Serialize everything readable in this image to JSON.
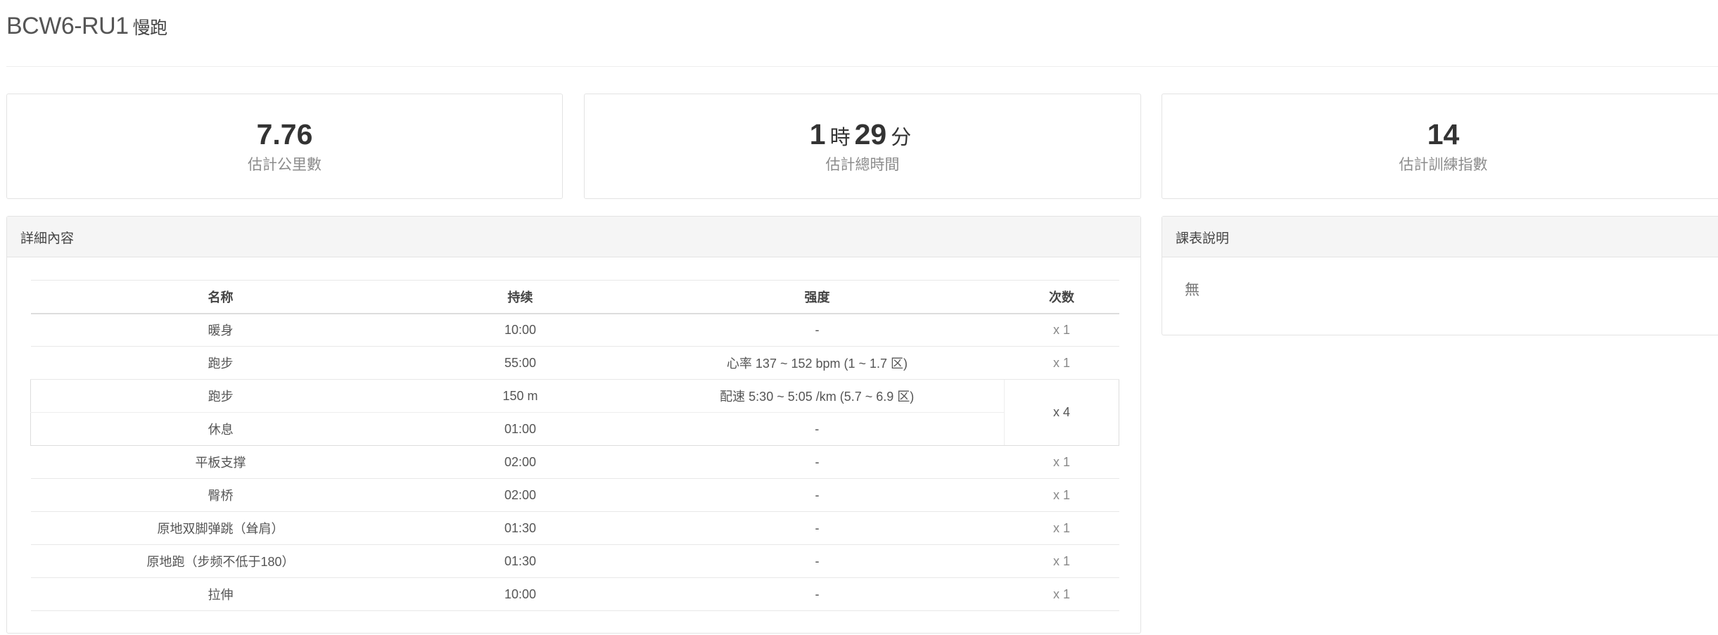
{
  "header": {
    "title": "BCW6-RU1",
    "subtitle": "慢跑"
  },
  "stats": {
    "distance": {
      "value": "7.76",
      "label": "估計公里數"
    },
    "duration": {
      "hours": "1",
      "hours_unit": "時",
      "minutes": "29",
      "minutes_unit": "分",
      "label": "估計總時間"
    },
    "training_index": {
      "value": "14",
      "label": "估計訓練指數"
    }
  },
  "detail": {
    "heading": "詳細內容",
    "columns": [
      "名称",
      "持续",
      "强度",
      "次数"
    ],
    "rows": [
      {
        "name": "暖身",
        "duration": "10:00",
        "intensity": "-",
        "count": "x 1"
      },
      {
        "name": "跑步",
        "duration": "55:00",
        "intensity": "心率 137 ~ 152 bpm (1 ~ 1.7 区)",
        "count": "x 1"
      }
    ],
    "group": {
      "count": "x 4",
      "rows": [
        {
          "name": "跑步",
          "duration": "150 m",
          "intensity": "配速 5:30 ~ 5:05 /km (5.7 ~ 6.9 区)"
        },
        {
          "name": "休息",
          "duration": "01:00",
          "intensity": "-"
        }
      ]
    },
    "rows_after": [
      {
        "name": "平板支撑",
        "duration": "02:00",
        "intensity": "-",
        "count": "x 1"
      },
      {
        "name": "臀桥",
        "duration": "02:00",
        "intensity": "-",
        "count": "x 1"
      },
      {
        "name": "原地双脚弹跳（耸肩）",
        "duration": "01:30",
        "intensity": "-",
        "count": "x 1"
      },
      {
        "name": "原地跑（步频不低于180）",
        "duration": "01:30",
        "intensity": "-",
        "count": "x 1"
      },
      {
        "name": "拉伸",
        "duration": "10:00",
        "intensity": "-",
        "count": "x 1"
      }
    ]
  },
  "notes": {
    "heading": "課表說明",
    "body": "無"
  }
}
